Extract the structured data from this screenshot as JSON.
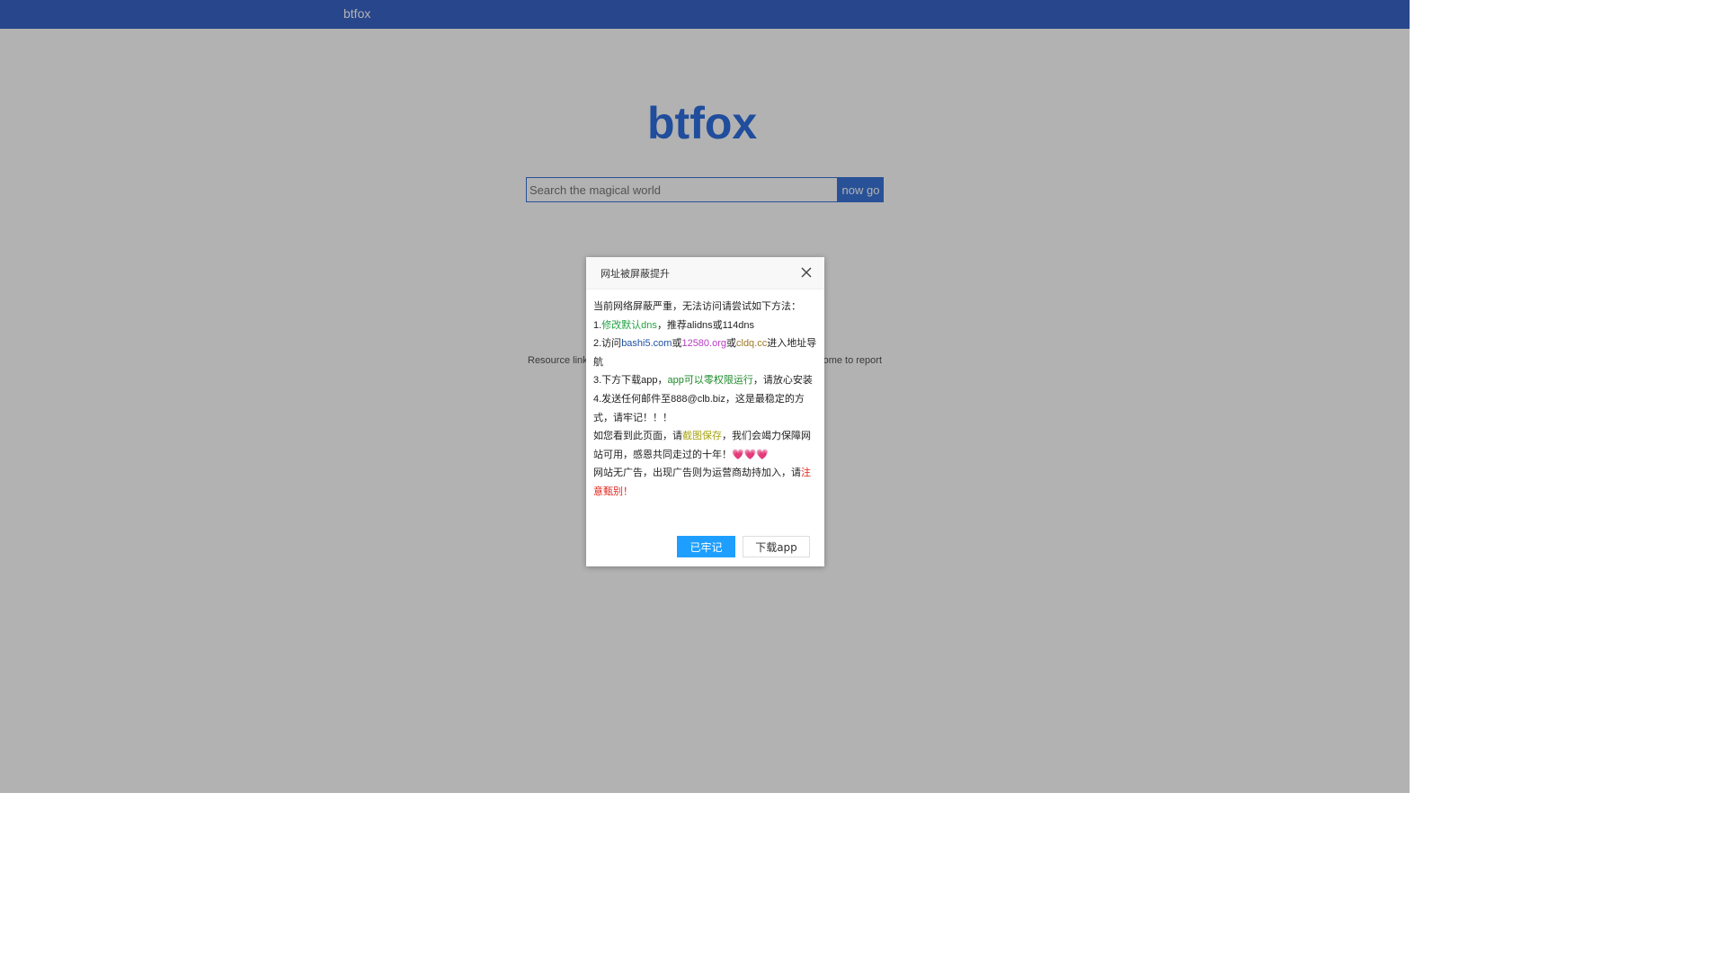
{
  "header": {
    "brand": "btfox"
  },
  "logo": {
    "text": "btfox"
  },
  "search": {
    "placeholder": "Search the magical world",
    "button_label": "now go"
  },
  "footer_links": {
    "left": "Resource link",
    "right": "ome to report"
  },
  "dialog": {
    "title": "网址被屏蔽提升",
    "lines": {
      "l0": "当前网络屏蔽严重，无法访问请尝试如下方法：",
      "l1_prefix": "1.",
      "l1_link": "修改默认dns",
      "l1_rest": "，推荐alidns或114dns",
      "l2_prefix": "2.访问",
      "l2_link1": "bashi5.com",
      "l2_or1": "或",
      "l2_link2": "12580.org",
      "l2_or2": "或",
      "l2_link3": "cldq.cc",
      "l2_rest": "进入地址导航",
      "l3_prefix": "3.下方下载app，",
      "l3_highlight": "app可以零权限运行",
      "l3_rest": "，请放心安装",
      "l4": "4.发送任何邮件至888@clb.biz，这是最稳定的方式，请牢记！！！",
      "l5_prefix": "如您看到此页面，请",
      "l5_highlight": "截图保存",
      "l5_rest": "，我们会竭力保障网站可用，感恩共同走过的十年！",
      "l5_hearts": "💗💗💗",
      "l6_prefix": "网站无广告，出现广告则为运营商劫持加入，请",
      "l6_highlight": "注意甄别！"
    },
    "confirm_label": "已牢记",
    "download_label": "下载app"
  }
}
